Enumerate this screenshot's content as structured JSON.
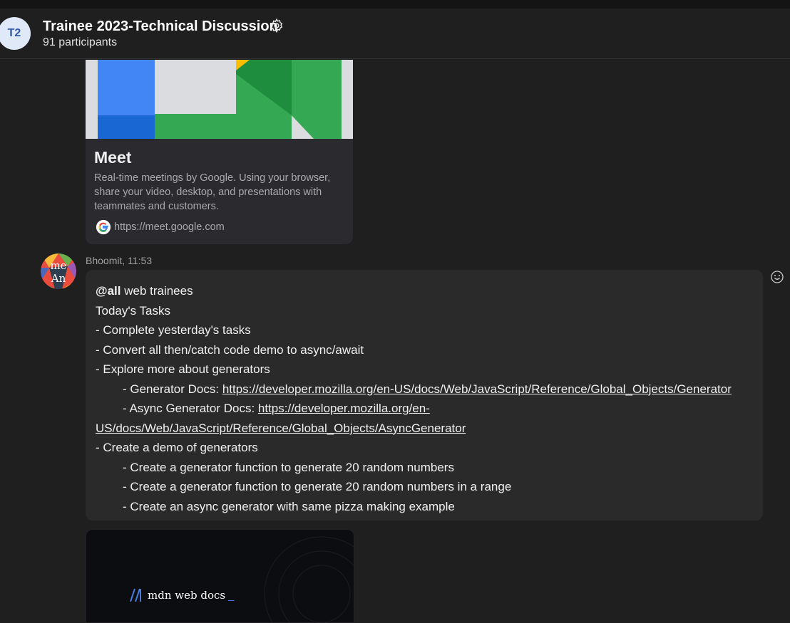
{
  "header": {
    "avatar_initials": "T2",
    "title": "Trainee 2023-Technical Discussion",
    "participants": "91 participants",
    "settings_icon": "gear-icon"
  },
  "preview_card": {
    "title": "Meet",
    "description": "Real-time meetings by Google. Using your browser, share your video, desktop, and presentations with teammates and customers.",
    "url": "https://meet.google.com",
    "favicon": "google-g-icon"
  },
  "message": {
    "sender": "Bhoomit, 11:53",
    "avatar_text_top": "me",
    "avatar_text_bottom": "An",
    "mention": "@all",
    "line1_rest": " web trainees",
    "line2": "Today's Tasks",
    "line3": "- Complete yesterday's tasks",
    "line4": "- Convert all then/catch code demo to async/await",
    "line5": "- Explore more about generators",
    "line6_prefix": "- Generator Docs: ",
    "line6_link": "https://developer.mozilla.org/en-US/docs/Web/JavaScript/Reference/Global_Objects/Generator",
    "line7_prefix": "- Async Generator Docs: ",
    "line7_link_a": "https://developer.mozilla.org/en-",
    "line8_link_b": "US/docs/Web/JavaScript/Reference/Global_Objects/AsyncGenerator",
    "line9": "- Create a demo of generators",
    "line10": "- Create a generator function to generate 20 random numbers",
    "line11": "- Create a generator function to generate 20 random numbers in a range",
    "line12": "- Create an async generator with same pizza making example",
    "reaction_icon": "smiley-icon"
  },
  "mdn_card": {
    "logo_text": "mdn web docs",
    "logo_cursor": "_"
  }
}
